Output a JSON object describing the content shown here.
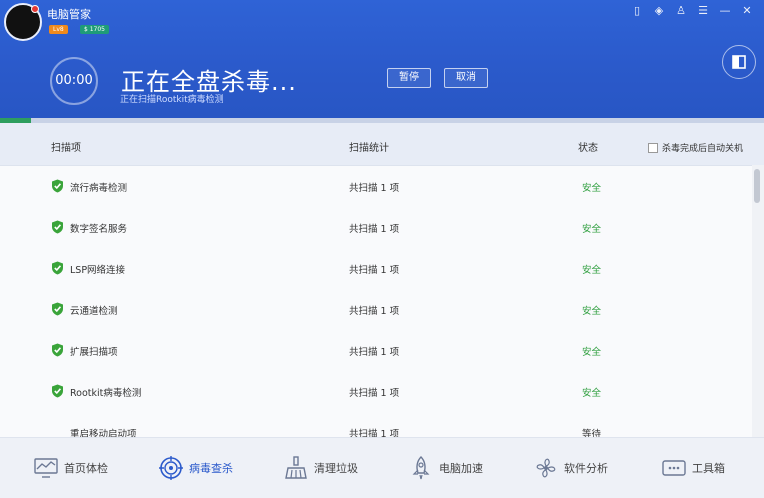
{
  "app": {
    "title": "电脑管家",
    "level_badge": "Lv8",
    "coin_badge": "$ 1705"
  },
  "window_controls": [
    {
      "name": "phone-icon",
      "glyph": "▯"
    },
    {
      "name": "shield-settings-icon",
      "glyph": "◈"
    },
    {
      "name": "shirt-icon",
      "glyph": "♙"
    },
    {
      "name": "menu-icon",
      "glyph": "☰"
    },
    {
      "name": "minimize-icon",
      "glyph": "—"
    },
    {
      "name": "close-icon",
      "glyph": "✕"
    }
  ],
  "scan": {
    "timer": "00:00",
    "title": "正在全盘杀毒...",
    "subtitle": "正在扫描Rootkit病毒检测",
    "pause_label": "暂停",
    "cancel_label": "取消",
    "progress": 0.04
  },
  "table": {
    "columns": [
      "扫描项",
      "扫描统计",
      "状态"
    ],
    "auto_shutdown_label": "杀毒完成后自动关机",
    "rows": [
      {
        "name": "流行病毒检测",
        "stat": "共扫描 1 项",
        "state": "安全"
      },
      {
        "name": "数字签名服务",
        "stat": "共扫描 1 项",
        "state": "安全"
      },
      {
        "name": "LSP网络连接",
        "stat": "共扫描 1 项",
        "state": "安全"
      },
      {
        "name": "云通道检测",
        "stat": "共扫描 1 项",
        "state": "安全"
      },
      {
        "name": "扩展扫描项",
        "stat": "共扫描 1 项",
        "state": "安全"
      },
      {
        "name": "Rootkit病毒检测",
        "stat": "共扫描 1 项",
        "state": "安全"
      },
      {
        "name": "重启移动启动项",
        "stat": "共扫描 1 项",
        "state": "等待"
      }
    ]
  },
  "bottom_nav": [
    {
      "label": "首页体检",
      "icon": "monitor-chart-icon",
      "active": false
    },
    {
      "label": "病毒查杀",
      "icon": "target-scan-icon",
      "active": true
    },
    {
      "label": "清理垃圾",
      "icon": "broom-icon",
      "active": false
    },
    {
      "label": "电脑加速",
      "icon": "rocket-icon",
      "active": false
    },
    {
      "label": "软件分析",
      "icon": "fan-icon",
      "active": false
    },
    {
      "label": "工具箱",
      "icon": "toolbox-icon",
      "active": false
    }
  ],
  "colors": {
    "header_blue": "#2b5acb",
    "safe_green": "#2e9e3e",
    "progress_green": "#2e9e5e"
  }
}
